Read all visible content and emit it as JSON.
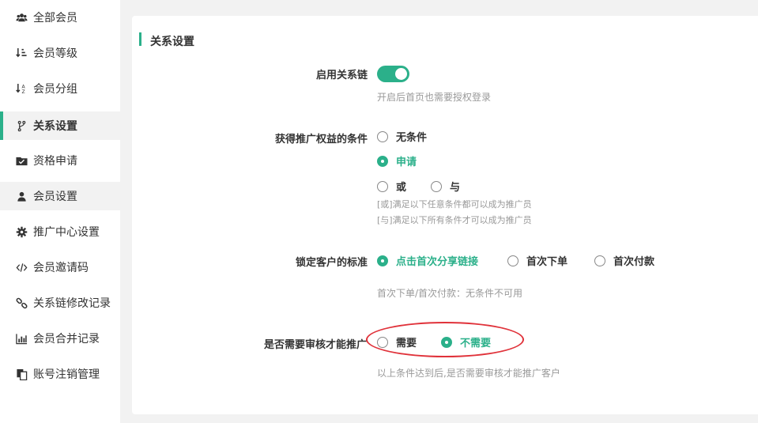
{
  "sidebar": {
    "items": [
      {
        "label": "全部会员"
      },
      {
        "label": "会员等级"
      },
      {
        "label": "会员分组"
      },
      {
        "label": "关系设置"
      },
      {
        "label": "资格申请"
      },
      {
        "label": "会员设置"
      },
      {
        "label": "推广中心设置"
      },
      {
        "label": "会员邀请码"
      },
      {
        "label": "关系链修改记录"
      },
      {
        "label": "会员合并记录"
      },
      {
        "label": "账号注销管理"
      }
    ]
  },
  "main": {
    "section_title": "关系设置",
    "enable_chain": {
      "label": "启用关系链",
      "enabled": true,
      "hint": "开启后首页也需要授权登录"
    },
    "promo_condition": {
      "label": "获得推广权益的条件",
      "options": [
        "无条件",
        "申请",
        "或",
        "与"
      ],
      "selected": "申请",
      "hint_or": "[或]满足以下任意条件都可以成为推广员",
      "hint_and": "[与]满足以下所有条件才可以成为推广员"
    },
    "lock_standard": {
      "label": "锁定客户的标准",
      "options": [
        "点击首次分享链接",
        "首次下单",
        "首次付款"
      ],
      "selected": "点击首次分享链接",
      "hint": "首次下单/首次付款：无条件不可用"
    },
    "review_required": {
      "label": "是否需要审核才能推广",
      "options": [
        "需要",
        "不需要"
      ],
      "selected": "不需要",
      "hint": "以上条件达到后,是否需要审核才能推广客户"
    }
  },
  "colors": {
    "accent": "#2bb08a",
    "annotation": "#e0323a"
  }
}
